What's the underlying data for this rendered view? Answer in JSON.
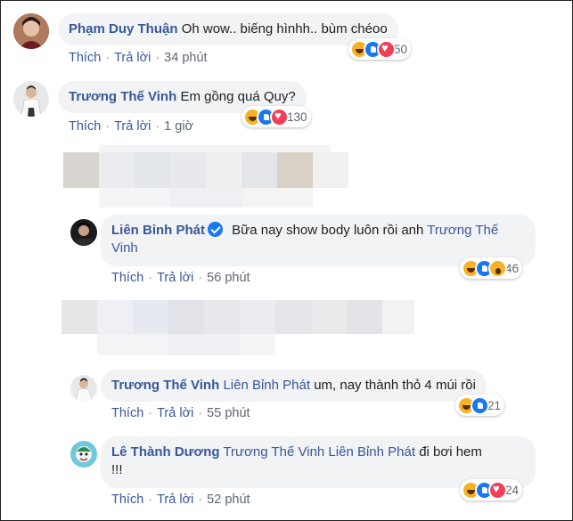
{
  "comments": [
    {
      "author": "Phạm Duy Thuận",
      "text": "Oh wow.. biếng hìnhh.. bùm chéoo",
      "like_label": "Thích",
      "reply_label": "Trả lời",
      "time": "34 phút",
      "reaction_count": "50",
      "reactions": [
        "haha-icon",
        "like-icon",
        "love-icon"
      ]
    },
    {
      "author": "Trương Thế Vinh",
      "text": "Em gồng quá Quy?",
      "like_label": "Thích",
      "reply_label": "Trả lời",
      "time": "1 giờ",
      "reaction_count": "130",
      "reactions": [
        "haha-icon",
        "like-icon",
        "love-icon"
      ]
    }
  ],
  "replies": [
    {
      "author": "Liên Bỉnh Phát",
      "verified": true,
      "text": "Bữa nay show body luôn rồi anh",
      "mention": "Trương Thế Vinh",
      "like_label": "Thích",
      "reply_label": "Trả lời",
      "time": "56 phút",
      "reaction_count": "46",
      "reactions": [
        "haha-icon",
        "like-icon",
        "wow-icon"
      ]
    },
    {
      "author": "Trương Thế Vinh",
      "mention": "Liên Bỉnh Phát",
      "text": "um, nay thành thỏ 4 múi rồi",
      "like_label": "Thích",
      "reply_label": "Trả lời",
      "time": "55 phút",
      "reaction_count": "21",
      "reactions": [
        "haha-icon",
        "like-icon"
      ]
    },
    {
      "author": "Lê Thành Dương",
      "mention": "Trương Thế Vinh Liên Bỉnh Phát",
      "text": "đi bơi hem",
      "text2": "!!!",
      "like_label": "Thích",
      "reply_label": "Trả lời",
      "time": "52 phút",
      "reaction_count": "24",
      "reactions": [
        "haha-icon",
        "like-icon",
        "love-icon"
      ]
    }
  ],
  "colors": {
    "name_link": "#385898",
    "bubble_bg": "#f2f3f5",
    "meta_text": "#606770"
  }
}
